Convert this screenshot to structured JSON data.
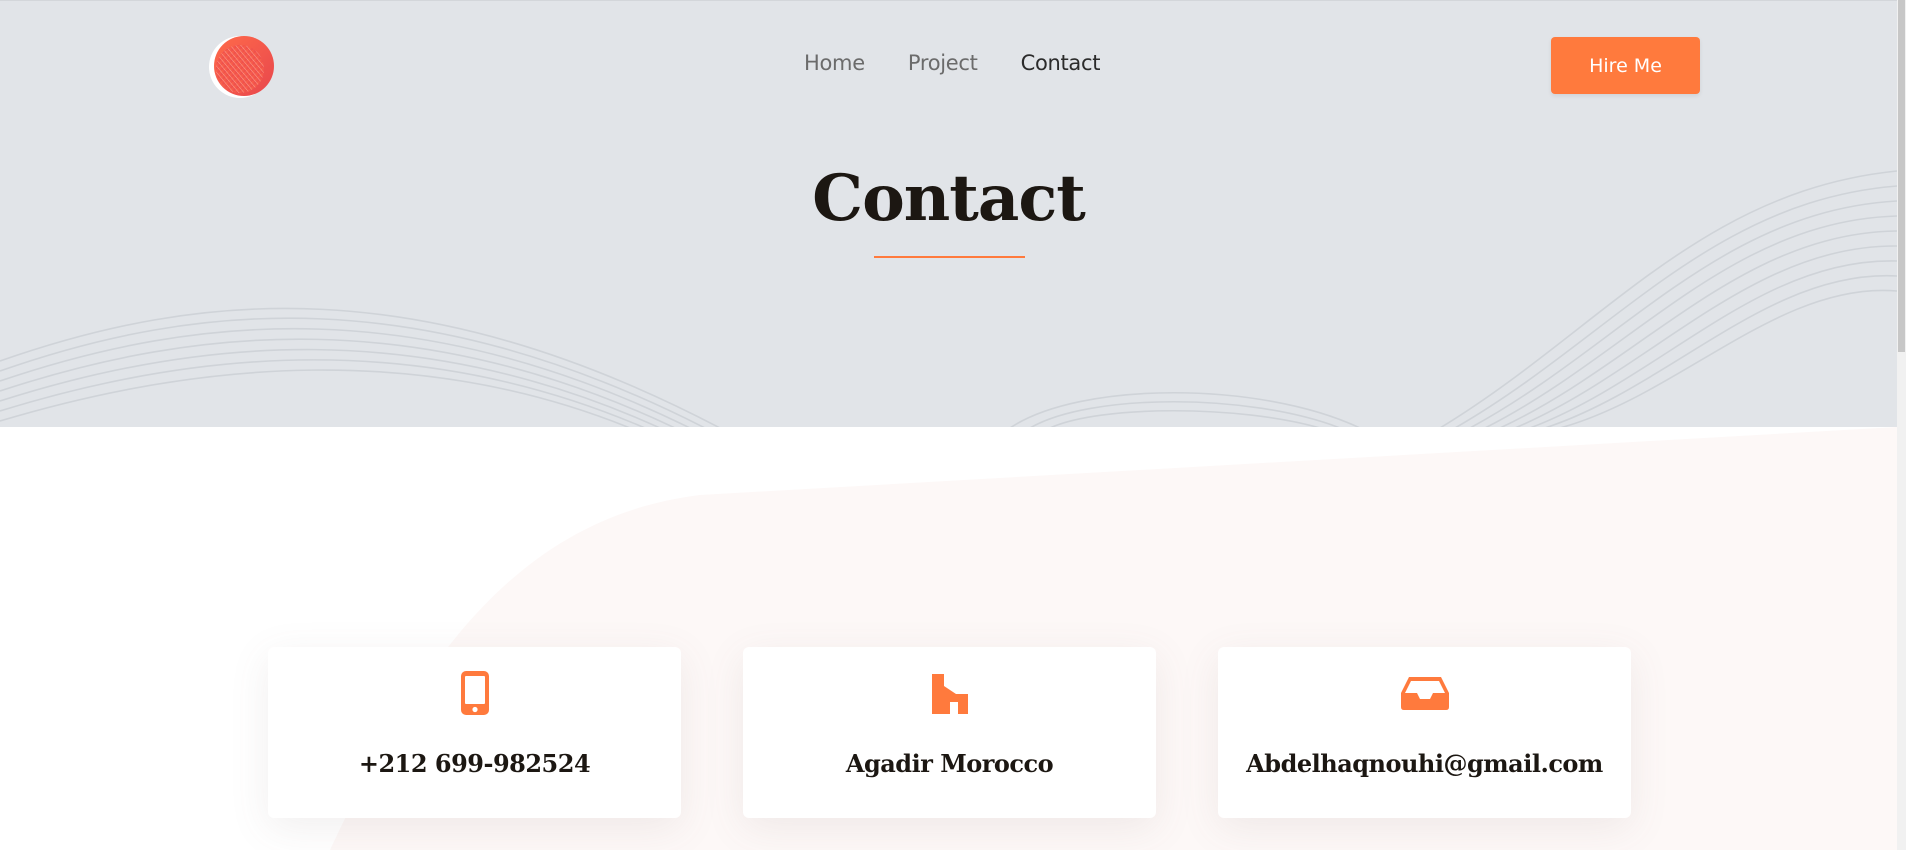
{
  "header": {
    "nav": [
      {
        "label": "Home",
        "active": false
      },
      {
        "label": "Project",
        "active": false
      },
      {
        "label": "Contact",
        "active": true
      }
    ],
    "hire_button_label": "Hire Me",
    "logo_icon": "circle-logo-icon"
  },
  "hero": {
    "title": "Contact"
  },
  "contact_cards": [
    {
      "icon": "mobile-phone-icon",
      "text": "+212 699-982524"
    },
    {
      "icon": "home-icon",
      "text": "Agadir Morocco"
    },
    {
      "icon": "inbox-icon",
      "text": "Abdelhaqnouhi@gmail.com"
    }
  ],
  "colors": {
    "accent": "#ff7a3d",
    "hero_bg": "#e1e4e8",
    "text_dark": "#1c1712",
    "nav_text": "#6b6b6b"
  }
}
